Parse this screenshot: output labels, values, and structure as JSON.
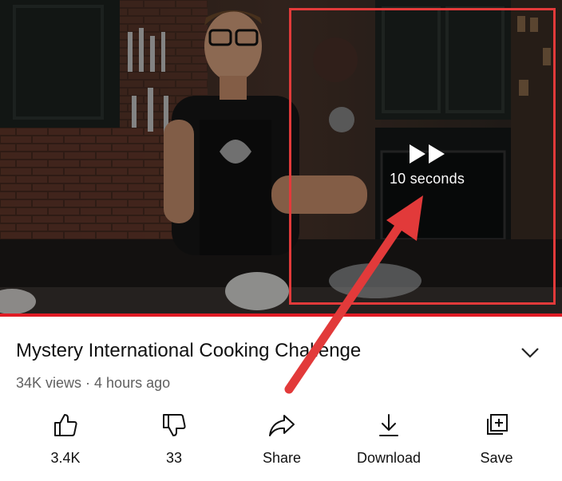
{
  "video": {
    "seek_label": "10 seconds"
  },
  "details": {
    "title": "Mystery International Cooking Challenge",
    "meta": "34K views · 4 hours ago"
  },
  "actions": {
    "like": "3.4K",
    "dislike": "33",
    "share": "Share",
    "download": "Download",
    "save": "Save"
  },
  "colors": {
    "annotation": "#e23a3a",
    "progress": "#e01b24"
  }
}
